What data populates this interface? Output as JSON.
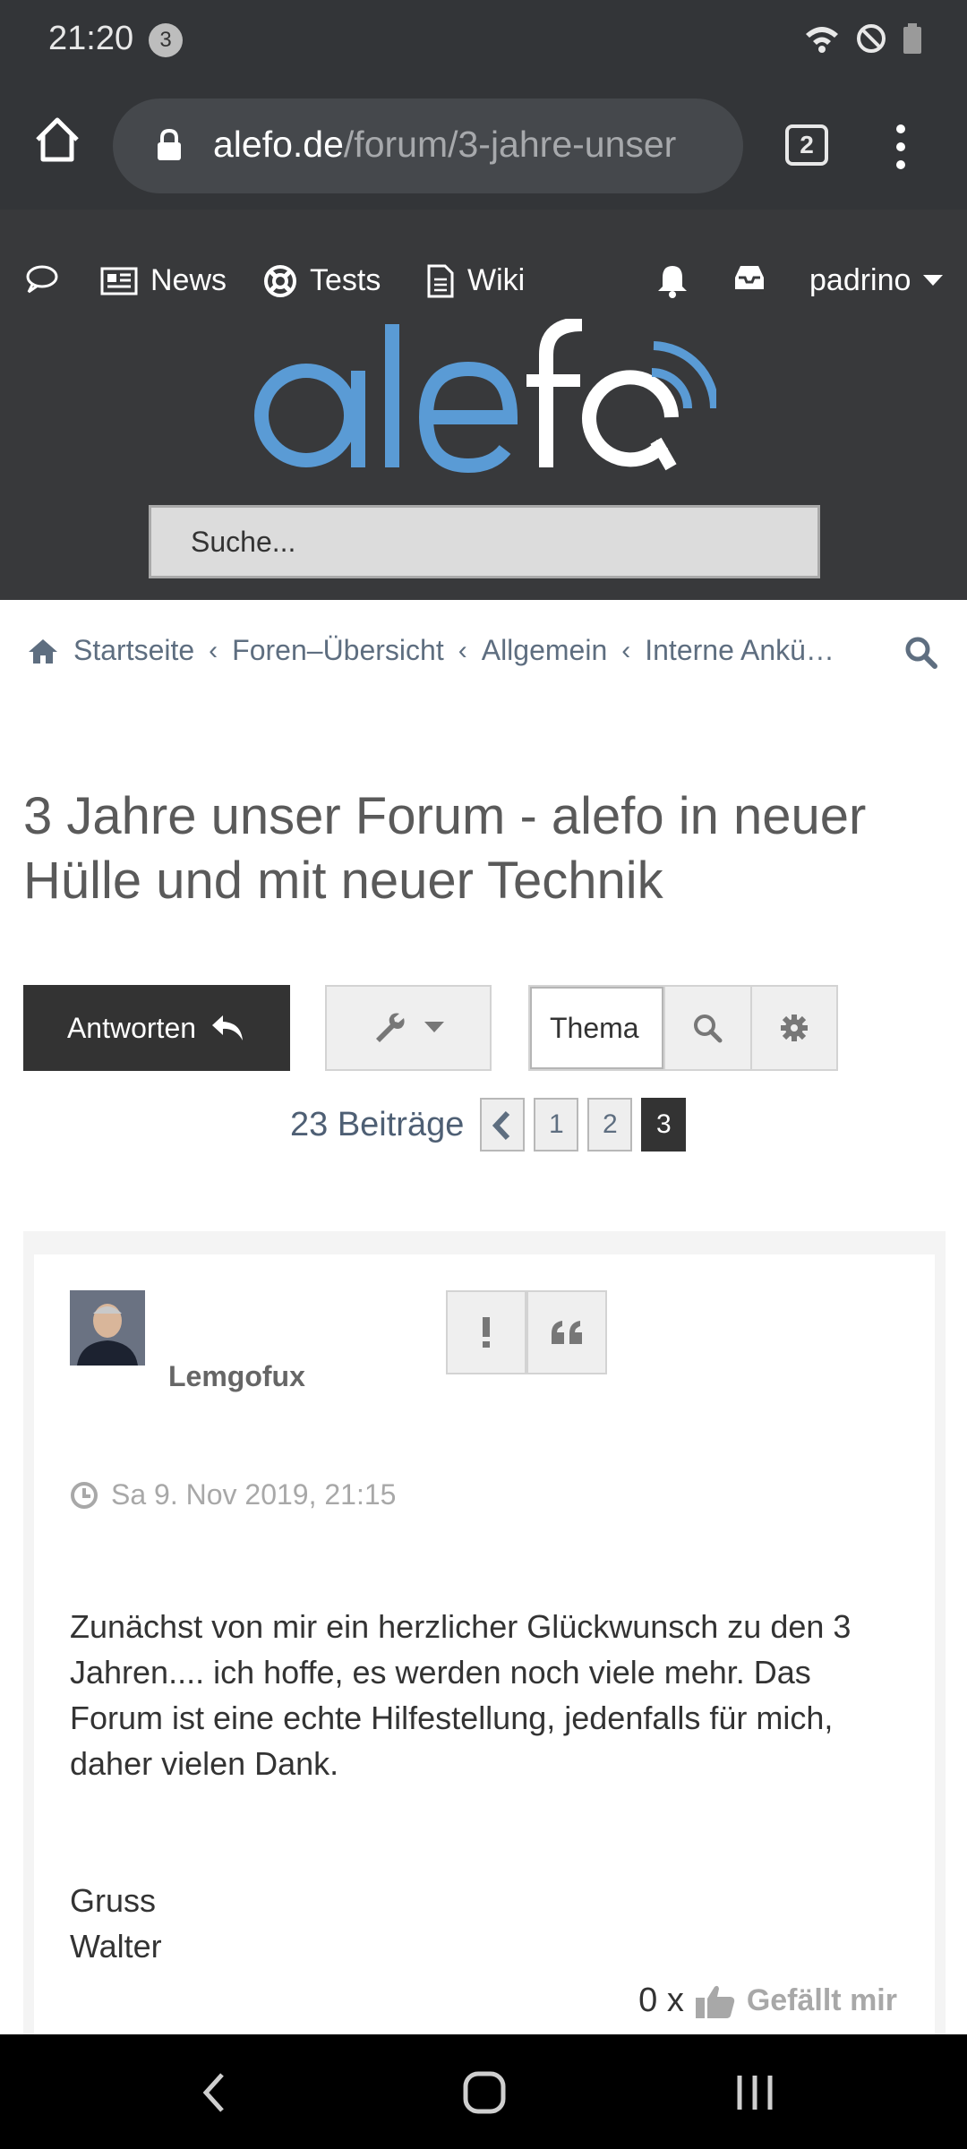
{
  "status": {
    "time": "21:20",
    "notif_count": "3"
  },
  "browser": {
    "url_domain": "alefo.de",
    "url_path": "/forum/3-jahre-unser",
    "tab_count": "2"
  },
  "nav": {
    "news": "News",
    "tests": "Tests",
    "wiki": "Wiki",
    "user": "padrino"
  },
  "logo_text": "alefo",
  "search_placeholder": "Suche...",
  "breadcrumb": [
    "Startseite",
    "Foren–Übersicht",
    "Allgemein",
    "Interne Ankü…"
  ],
  "topic_title": "3 Jahre unser Forum - alefo in neuer Hülle und mit neuer Technik",
  "reply_label": "Antworten",
  "topic_search_value": "Thema",
  "pagination": {
    "count": "23 Beiträge",
    "pages": [
      "1",
      "2",
      "3"
    ],
    "current": "3"
  },
  "post": {
    "author": "Lemgofux",
    "date": "Sa 9. Nov 2019, 21:15",
    "paragraphs": [
      "Zunächst von mir ein herzlicher Glückwunsch zu den 3 Jahren.... ich hoffe, es werden noch viele mehr. Das Forum ist eine echte Hilfestellung, jedenfalls für mich, daher vielen Dank.",
      "Gruss\nWalter"
    ],
    "like_count": "0 x",
    "like_label": "Gefällt mir"
  },
  "colors": {
    "header_bg": "#38393b",
    "logo_blue": "#5a9bd5",
    "link": "#5e6e80"
  }
}
